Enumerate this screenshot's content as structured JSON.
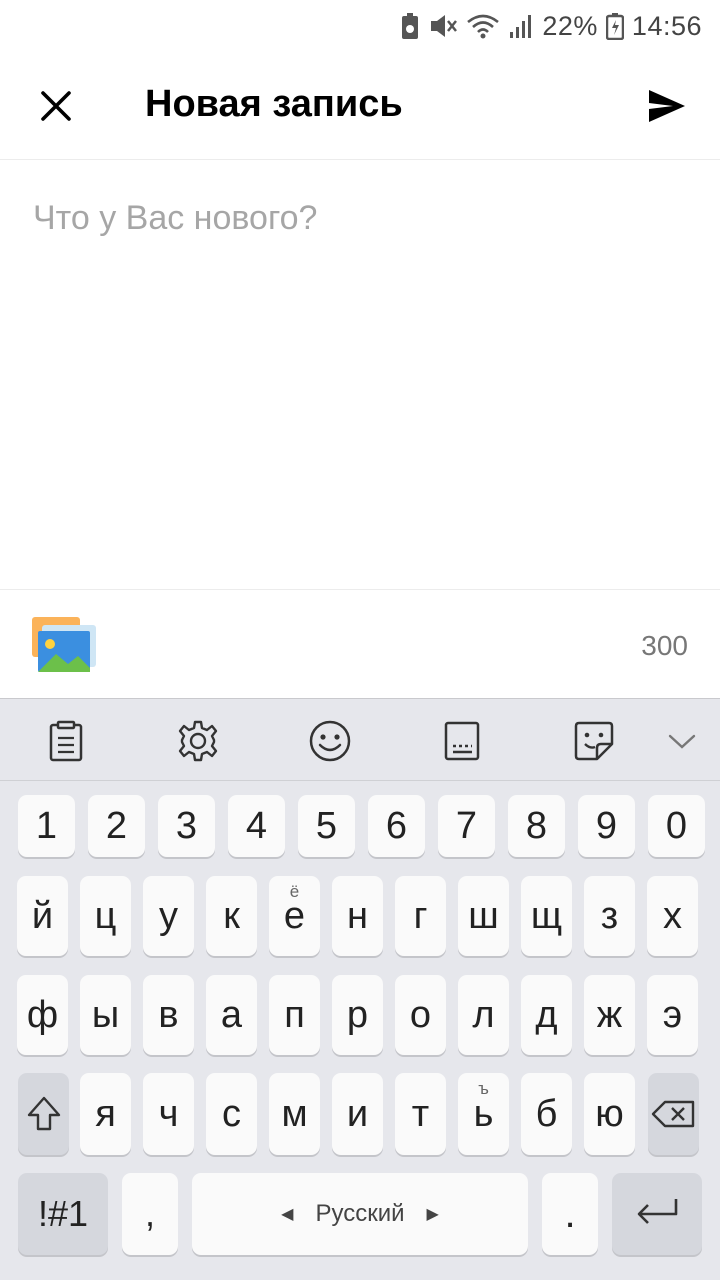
{
  "status_bar": {
    "battery_percent": "22%",
    "time": "14:56"
  },
  "app_bar": {
    "title": "Новая запись"
  },
  "compose": {
    "placeholder": "Что у Вас нового?",
    "char_counter": "300"
  },
  "keyboard": {
    "toolbar": [
      "clipboard-icon",
      "gear-icon",
      "emoji-icon",
      "keyboard-icon",
      "sticker-icon",
      "chevron-down-icon"
    ],
    "number_row": [
      "1",
      "2",
      "3",
      "4",
      "5",
      "6",
      "7",
      "8",
      "9",
      "0"
    ],
    "row1": [
      {
        "label": "й",
        "hint": ""
      },
      {
        "label": "ц",
        "hint": ""
      },
      {
        "label": "у",
        "hint": ""
      },
      {
        "label": "к",
        "hint": ""
      },
      {
        "label": "е",
        "hint": "ё"
      },
      {
        "label": "н",
        "hint": ""
      },
      {
        "label": "г",
        "hint": ""
      },
      {
        "label": "ш",
        "hint": ""
      },
      {
        "label": "щ",
        "hint": ""
      },
      {
        "label": "з",
        "hint": ""
      },
      {
        "label": "х",
        "hint": ""
      }
    ],
    "row2": [
      "ф",
      "ы",
      "в",
      "а",
      "п",
      "р",
      "о",
      "л",
      "д",
      "ж",
      "э"
    ],
    "row3": [
      {
        "label": "я",
        "hint": ""
      },
      {
        "label": "ч",
        "hint": ""
      },
      {
        "label": "с",
        "hint": ""
      },
      {
        "label": "м",
        "hint": ""
      },
      {
        "label": "и",
        "hint": ""
      },
      {
        "label": "т",
        "hint": ""
      },
      {
        "label": "ь",
        "hint": "ъ"
      },
      {
        "label": "б",
        "hint": ""
      },
      {
        "label": "ю",
        "hint": ""
      }
    ],
    "symbols_key": "!#1",
    "comma_key": ",",
    "space_label": "Русский",
    "period_key": "."
  }
}
